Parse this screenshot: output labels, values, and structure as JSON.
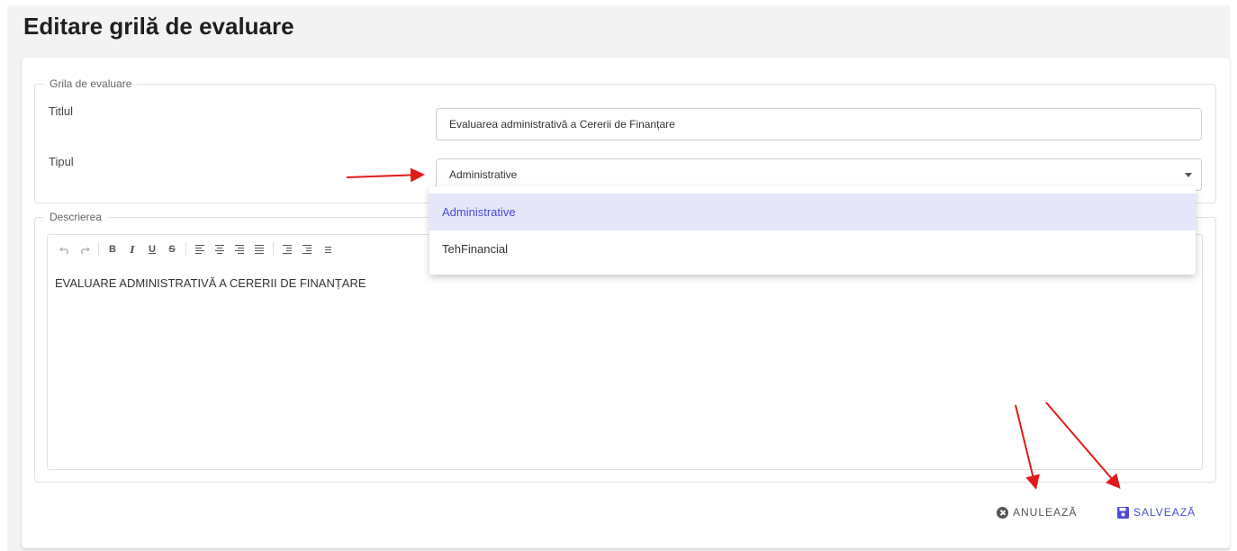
{
  "page": {
    "title": "Editare grilă de evaluare"
  },
  "grila": {
    "legend": "Grila de evaluare",
    "title_label": "Titlul",
    "title_value": "Evaluarea administrativă a Cererii de Finanțare",
    "type_label": "Tipul",
    "type_value": "Administrative",
    "type_options": [
      "Administrative",
      "TehFinancial"
    ]
  },
  "description": {
    "legend": "Descrierea",
    "content": "EVALUARE ADMINISTRATIVĂ A CERERII DE FINANȚARE"
  },
  "toolbar": {
    "bold": "B",
    "italic": "I",
    "underline": "U",
    "strike": "S"
  },
  "actions": {
    "cancel_label": "ANULEAZĂ",
    "save_label": "SALVEAZĂ"
  },
  "colors": {
    "accent": "#4b4bd6",
    "selected_bg": "#e6e6fa",
    "annotation": "#e41a1a"
  },
  "icons": [
    "undo-icon",
    "redo-icon",
    "align-left-icon",
    "align-center-icon",
    "align-right-icon",
    "align-justify-icon",
    "indent-icon",
    "outdent-icon",
    "bullet-list-icon",
    "close-circle-icon",
    "floppy-disk-icon",
    "dropdown-caret-icon"
  ]
}
